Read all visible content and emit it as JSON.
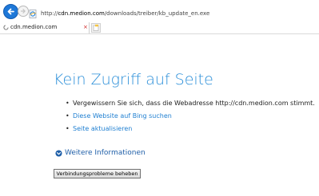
{
  "browser": {
    "url_prefix": "http://",
    "url_host": "cdn.medion.com",
    "url_path": "/downloads/treiber/kb_update_en.exe",
    "tab_title": "cdn.medion.com",
    "tab_close_glyph": "×"
  },
  "error": {
    "title": "Kein Zugriff auf Seite",
    "bullet_glyph": "•",
    "suggestion_check_address": "Vergewissern Sie sich, dass die Webadresse http://cdn.medion.com stimmt.",
    "suggestion_bing_link": "Diese Website auf Bing suchen",
    "suggestion_refresh_link": "Seite aktualisieren",
    "more_info_label": "Weitere Informationen",
    "fix_button_label": "Verbindungsprobleme beheben"
  },
  "icons": {
    "back": "back-arrow-icon",
    "forward": "forward-arrow-icon",
    "site": "ie-page-icon",
    "loading": "loading-spinner-icon",
    "new_tab": "new-tab-icon",
    "expand": "chevron-down-circle-icon"
  },
  "colors": {
    "accent_blue": "#1e78d8",
    "title_blue": "#2b8fd9",
    "link_blue": "#1f7fd1",
    "more_info_blue": "#1f5fa8",
    "tab_close_red": "#cc1f1f"
  }
}
